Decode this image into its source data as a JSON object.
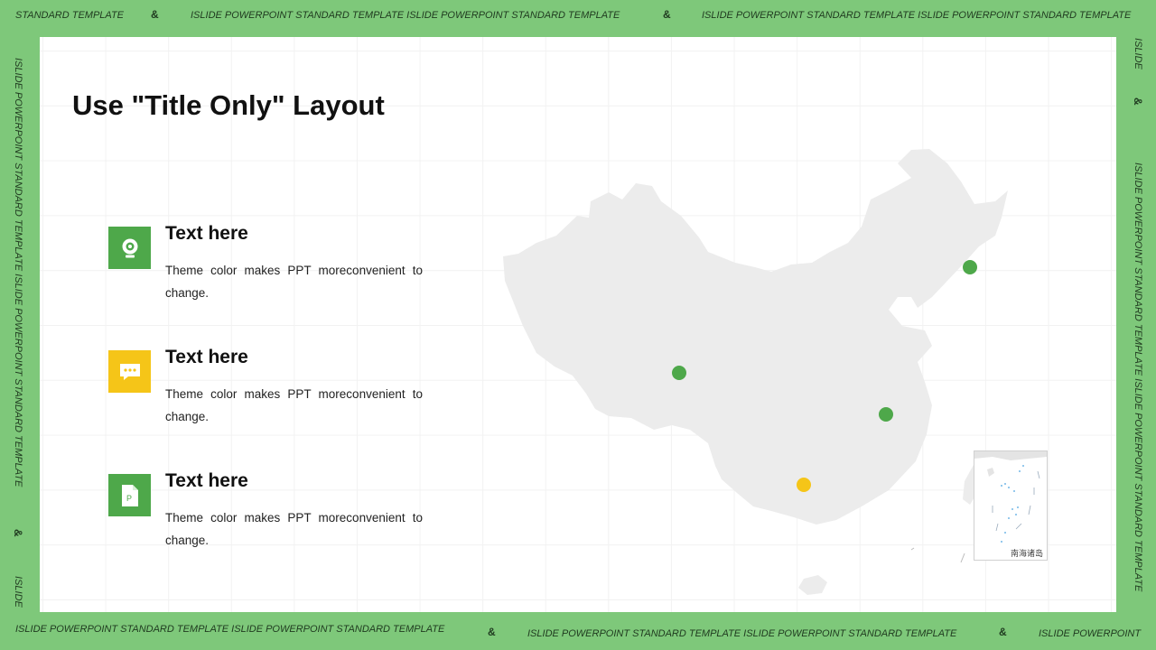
{
  "border": {
    "top": [
      "STANDARD TEMPLATE",
      "&",
      "ISLIDE POWERPOINT STANDARD TEMPLATE ISLIDE POWERPOINT STANDARD TEMPLATE",
      "&",
      "ISLIDE POWERPOINT STANDARD TEMPLATE ISLIDE POWERPOINT STANDARD TEMPLATE"
    ],
    "bottom": [
      "ISLIDE POWERPOINT STANDARD TEMPLATE ISLIDE POWERPOINT STANDARD TEMPLATE",
      "&",
      "ISLIDE POWERPOINT STANDARD TEMPLATE ISLIDE POWERPOINT STANDARD TEMPLATE",
      "&",
      "ISLIDE POWERPOINT"
    ],
    "left": [
      "ISLIDE POWERPOINT STANDARD TEMPLATE ISLIDE POWERPOINT STANDARD TEMPLATE",
      "&",
      "ISLIDE"
    ],
    "right": [
      "ISLIDE",
      "&",
      "ISLIDE POWERPOINT STANDARD TEMPLATE ISLIDE POWERPOINT STANDARD TEMPLATE"
    ],
    "color": "#7ec87a"
  },
  "slide": {
    "title": "Use \"Title Only\" Layout",
    "items": [
      {
        "heading": "Text here",
        "body": "Theme color makes PPT moreconvenient to change.",
        "icon": "camera-icon",
        "color": "#4ea84a"
      },
      {
        "heading": "Text here",
        "body": "Theme color makes PPT moreconvenient to change.",
        "icon": "chat-bubble-icon",
        "color": "#f5c518"
      },
      {
        "heading": "Text here",
        "body": "Theme color makes PPT moreconvenient to change.",
        "icon": "ppt-file-icon",
        "color": "#4ea84a"
      }
    ],
    "map": {
      "inset_label": "南海诸岛",
      "marker_colors": [
        "#4ea84a",
        "#4ea84a",
        "#4ea84a",
        "#f5c518"
      ]
    }
  }
}
